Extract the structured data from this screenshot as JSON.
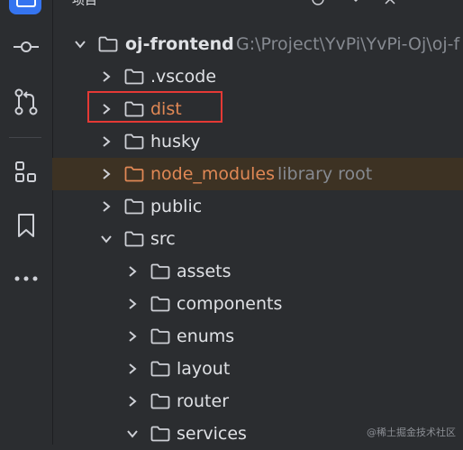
{
  "window": {
    "panel_title": "项目"
  },
  "toolbar_icons": [
    "globe-icon",
    "chevron-down-icon",
    "close-icon",
    "more-icon"
  ],
  "activity_bar": [
    {
      "name": "project-tool-icon",
      "active": true
    },
    {
      "name": "commit-icon"
    },
    {
      "name": "pull-requests-icon"
    },
    {
      "name": "structure-icon"
    },
    {
      "name": "bookmarks-icon"
    },
    {
      "name": "more-tools-icon"
    }
  ],
  "tree": {
    "root": {
      "label": "oj-frontend",
      "path": "G:\\Project\\YvPi\\YvPi-Oj\\oj-f"
    },
    "items": [
      {
        "label": ".vscode"
      },
      {
        "label": "dist",
        "excluded": true
      },
      {
        "label": "husky"
      },
      {
        "label": "node_modules",
        "suffix": "library root",
        "excluded": true
      },
      {
        "label": "public"
      },
      {
        "label": "src",
        "expanded": true
      },
      {
        "label": "assets"
      },
      {
        "label": "components"
      },
      {
        "label": "enums"
      },
      {
        "label": "layout"
      },
      {
        "label": "router"
      },
      {
        "label": "services",
        "expanded": true
      }
    ]
  },
  "colors": {
    "background": "#2b2d30",
    "excluded_text": "#e08855",
    "highlight_row": "#3d3223",
    "annotation_box": "#e53935",
    "accent": "#3574f0"
  },
  "watermark": "@稀土掘金技术社区"
}
